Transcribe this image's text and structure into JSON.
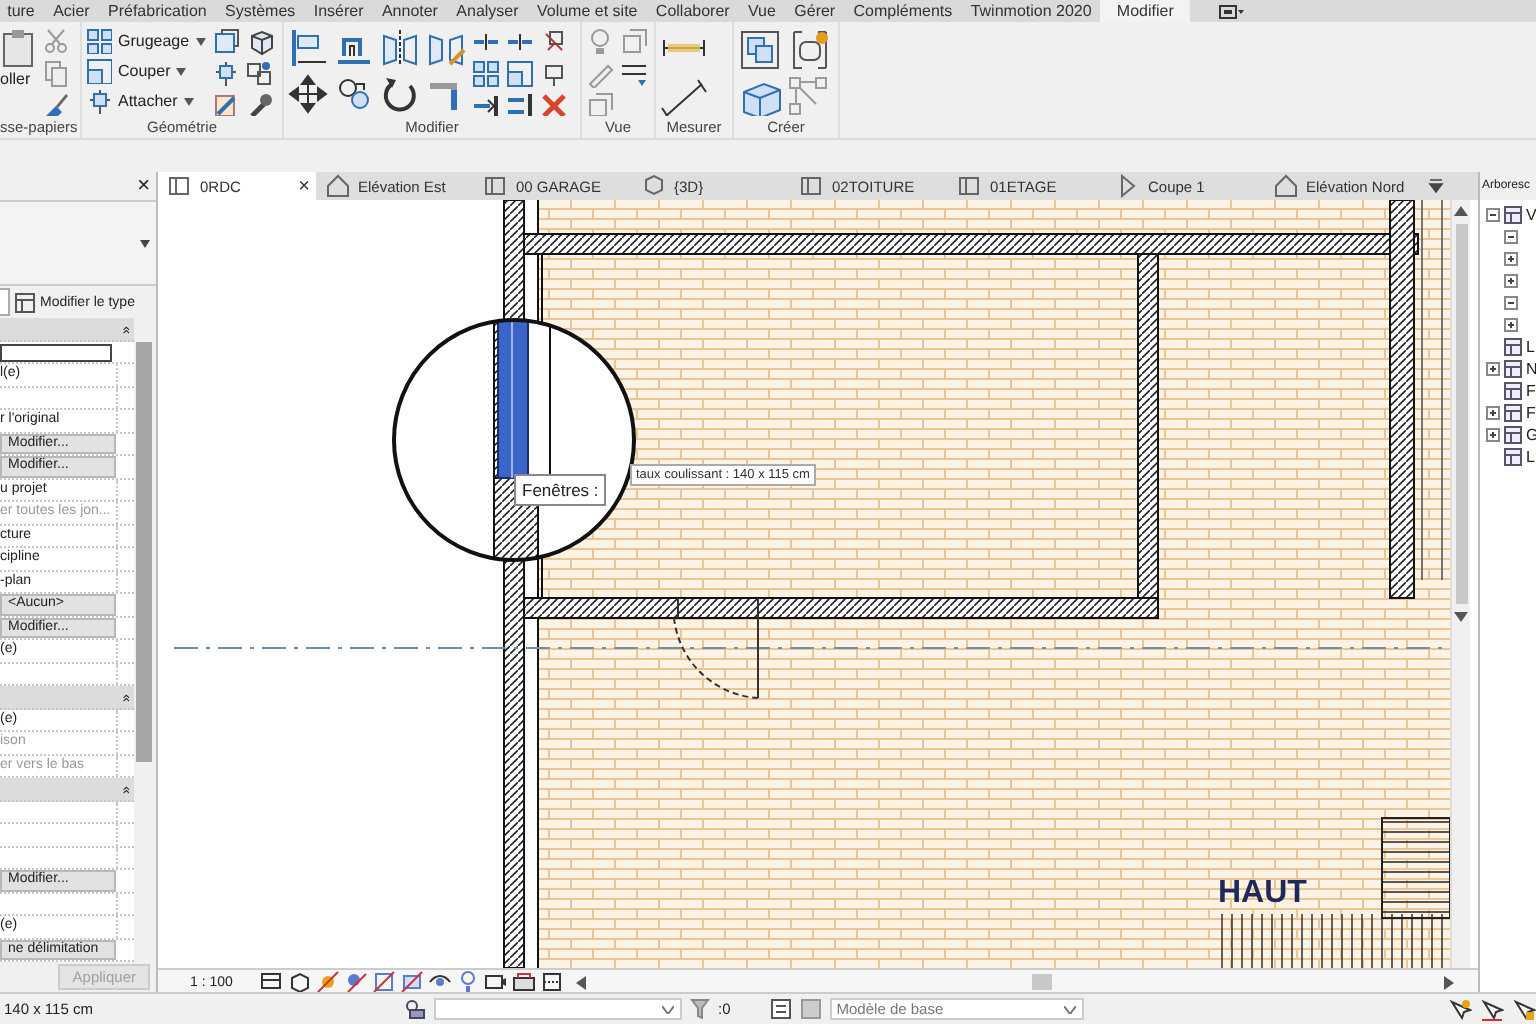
{
  "menu_tabs": [
    {
      "label": "ture",
      "selected": false
    },
    {
      "label": "Acier",
      "selected": false
    },
    {
      "label": "Préfabrication",
      "selected": false
    },
    {
      "label": "Systèmes",
      "selected": false
    },
    {
      "label": "Insérer",
      "selected": false
    },
    {
      "label": "Annoter",
      "selected": false
    },
    {
      "label": "Analyser",
      "selected": false
    },
    {
      "label": "Volume et site",
      "selected": false
    },
    {
      "label": "Collaborer",
      "selected": false
    },
    {
      "label": "Vue",
      "selected": false
    },
    {
      "label": "Gérer",
      "selected": false
    },
    {
      "label": "Compléments",
      "selected": false
    },
    {
      "label": "Twinmotion 2020",
      "selected": false
    },
    {
      "label": "Modifier",
      "selected": true
    }
  ],
  "ribbon": {
    "panels": [
      {
        "label": "sse-papiers",
        "tools": [
          {
            "label": "oller"
          }
        ]
      },
      {
        "label": "Géométrie",
        "tools": [
          {
            "label": "Grugeage"
          },
          {
            "label": "Couper"
          },
          {
            "label": "Attacher"
          }
        ]
      },
      {
        "label": "Modifier"
      },
      {
        "label": "Vue"
      },
      {
        "label": "Mesurer"
      },
      {
        "label": "Créer"
      }
    ]
  },
  "properties": {
    "close": "×",
    "type_button": "Modifier le type",
    "rows": [
      {
        "kind": "header",
        "collapse": "»"
      },
      {
        "kind": "input"
      },
      {
        "kind": "text",
        "text": "l(e)",
        "disabled": false
      },
      {
        "kind": "empty"
      },
      {
        "kind": "text",
        "text": "r l'original",
        "disabled": false
      },
      {
        "kind": "button",
        "text": "Modifier..."
      },
      {
        "kind": "button",
        "text": "Modifier..."
      },
      {
        "kind": "text",
        "text": "u projet",
        "disabled": false
      },
      {
        "kind": "text",
        "text": "er toutes les jon...",
        "disabled": true
      },
      {
        "kind": "text",
        "text": "cture",
        "disabled": false
      },
      {
        "kind": "text",
        "text": "cipline",
        "disabled": false
      },
      {
        "kind": "text",
        "text": "-plan",
        "disabled": false
      },
      {
        "kind": "button",
        "text": "<Aucun>"
      },
      {
        "kind": "button",
        "text": "Modifier..."
      },
      {
        "kind": "text",
        "text": "(e)",
        "disabled": false
      },
      {
        "kind": "empty"
      },
      {
        "kind": "header",
        "collapse": "»"
      },
      {
        "kind": "text",
        "text": "(e)",
        "disabled": false
      },
      {
        "kind": "text",
        "text": "ison",
        "disabled": true
      },
      {
        "kind": "text",
        "text": "er vers le bas",
        "disabled": true
      },
      {
        "kind": "header",
        "collapse": "»"
      },
      {
        "kind": "empty"
      },
      {
        "kind": "empty"
      },
      {
        "kind": "empty"
      },
      {
        "kind": "button",
        "text": "Modifier..."
      },
      {
        "kind": "empty"
      },
      {
        "kind": "text",
        "text": "(e)",
        "disabled": false
      },
      {
        "kind": "button",
        "text": "ne délimitation"
      }
    ],
    "apply_button": {
      "label": "Appliquer",
      "disabled": true
    }
  },
  "view_tabs": [
    {
      "label": "0RDC",
      "kind": "plan",
      "selected": true,
      "close": "×"
    },
    {
      "label": "Elévation Est",
      "kind": "elevation",
      "selected": false
    },
    {
      "label": "00 GARAGE",
      "kind": "plan",
      "selected": false
    },
    {
      "label": "{3D}",
      "kind": "threed",
      "selected": false
    },
    {
      "label": "02TOITURE",
      "kind": "plan",
      "selected": false
    },
    {
      "label": "01ETAGE",
      "kind": "plan",
      "selected": false
    },
    {
      "label": "Coupe 1",
      "kind": "section",
      "selected": false
    },
    {
      "label": "Elévation Nord",
      "kind": "elevation",
      "selected": false
    }
  ],
  "canvas": {
    "tooltip": "Fenêtres :",
    "tooltip_behind": "taux coulissant : 140 x 115 cm",
    "stair_label": "HAUT"
  },
  "project_browser": {
    "title": "Arboresc",
    "tree": [
      {
        "label": "V",
        "expanded": true,
        "children": [
          {
            "expanded": true
          },
          {
            "expanded": false
          },
          {
            "expanded": false
          },
          {
            "expanded": true
          },
          {
            "expanded": false
          }
        ]
      },
      {
        "label": "L"
      },
      {
        "label": "N",
        "expanded": false
      },
      {
        "label": "F"
      },
      {
        "label": "F",
        "expanded": false
      },
      {
        "label": "G",
        "expanded": false
      },
      {
        "label": "L"
      }
    ]
  },
  "view_control": {
    "scale": "1 : 100"
  },
  "status_bar": {
    "selection": "140 x 115 cm",
    "counter": ":0",
    "model": "Modèle de base"
  }
}
